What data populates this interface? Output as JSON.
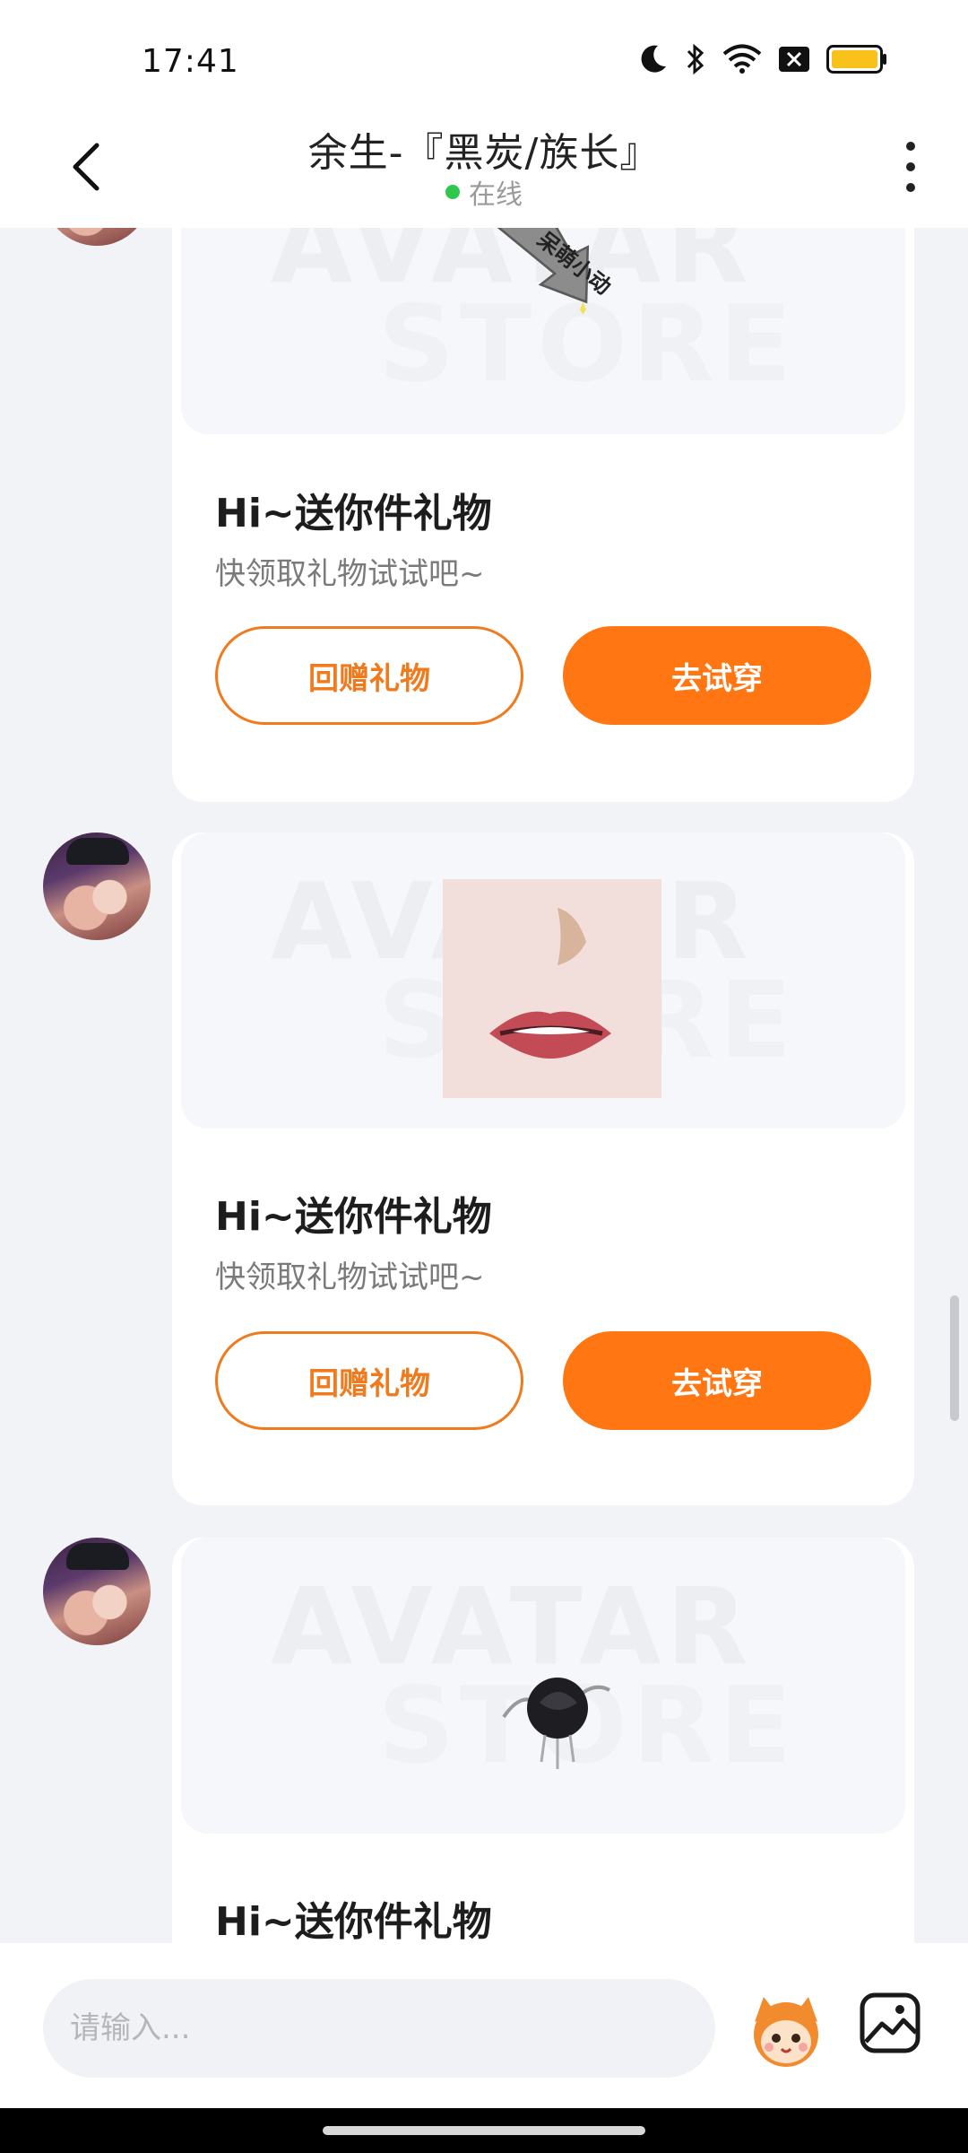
{
  "status_bar": {
    "time": "17:41"
  },
  "header": {
    "title": "余生-『黑炭/族长』",
    "status": "在线"
  },
  "messages": [
    {
      "gift_label": "呆萌小动",
      "title": "Hi~送你件礼物",
      "subtitle": "快领取礼物试试吧~",
      "return_button": "回赠礼物",
      "try_button": "去试穿"
    },
    {
      "title": "Hi~送你件礼物",
      "subtitle": "快领取礼物试试吧~",
      "return_button": "回赠礼物",
      "try_button": "去试穿"
    },
    {
      "title": "Hi~送你件礼物"
    }
  ],
  "watermark": {
    "line1": "AVATAR",
    "line2": "STORE"
  },
  "input": {
    "placeholder": "请输入..."
  },
  "colors": {
    "accent": "#FF7612",
    "online": "#2DC84D",
    "background": "#F2F3F7"
  }
}
